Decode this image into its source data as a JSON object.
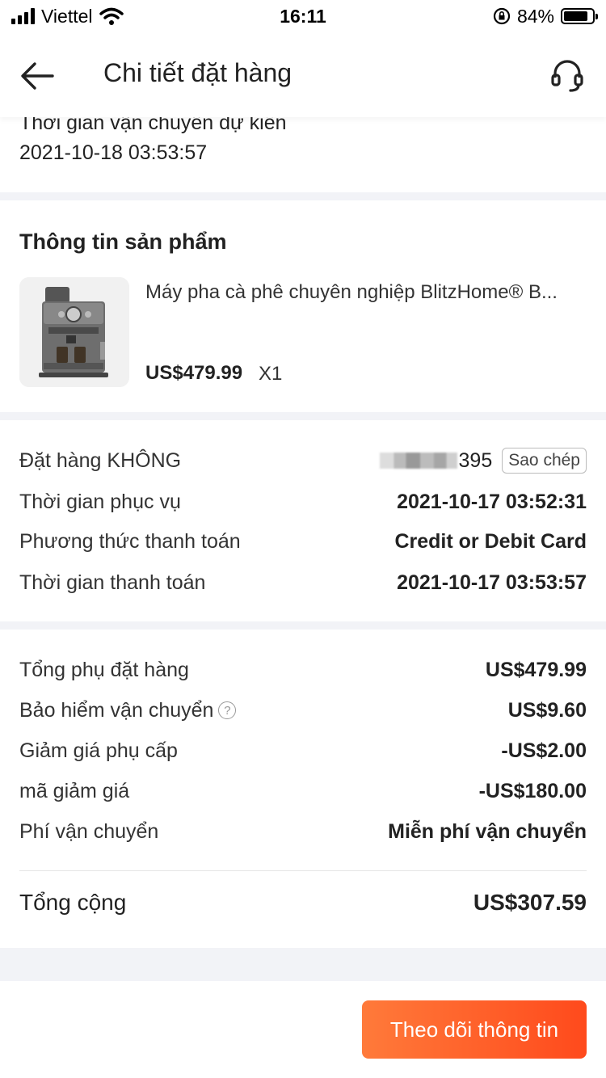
{
  "status_bar": {
    "carrier": "Viettel",
    "time": "16:11",
    "battery_percent": "84%",
    "battery_level": 0.84
  },
  "header": {
    "title": "Chi tiết đặt hàng",
    "back_icon": "arrow-left-icon",
    "support_icon": "headset-icon"
  },
  "delivery": {
    "label": "Thời gian vận chuyển dự kiến",
    "value": "2021-10-18 03:53:57"
  },
  "product_section": {
    "title": "Thông tin sản phẩm",
    "name": "Máy pha cà phê chuyên nghiệp BlitzHome® B...",
    "price": "US$479.99",
    "quantity": "X1"
  },
  "order_info": {
    "order_no_label": "Đặt hàng KHÔNG",
    "order_no_suffix": "395",
    "copy_label": "Sao chép",
    "service_time_label": "Thời gian phục vụ",
    "service_time_value": "2021-10-17 03:52:31",
    "payment_method_label": "Phương thức thanh toán",
    "payment_method_value": "Credit or Debit Card",
    "payment_time_label": "Thời gian thanh toán",
    "payment_time_value": "2021-10-17 03:53:57"
  },
  "totals": {
    "subtotal_label": "Tổng phụ đặt hàng",
    "subtotal_value": "US$479.99",
    "insurance_label": "Bảo hiểm vận chuyển",
    "insurance_value": "US$9.60",
    "allowance_label": "Giảm giá phụ cấp",
    "allowance_value": "-US$2.00",
    "coupon_label": "mã giảm giá",
    "coupon_value": "-US$180.00",
    "shipping_label": "Phí vận chuyển",
    "shipping_value": "Miễn phí vận chuyển",
    "total_label": "Tổng cộng",
    "total_value": "US$307.59"
  },
  "bottom": {
    "track_label": "Theo dõi thông tin",
    "accent_color": "#ff5a28"
  }
}
